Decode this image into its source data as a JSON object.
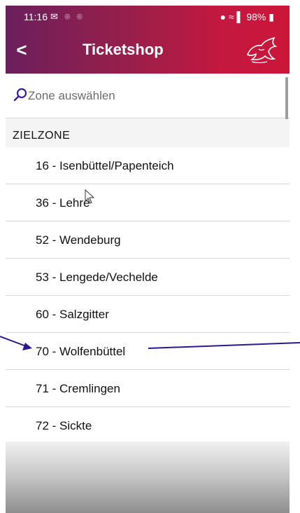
{
  "status": {
    "time": "11:16",
    "left_icons": "✉ ⌾ ⌾",
    "right": "98%",
    "battery_icon": "battery-icon",
    "wifi_icon": "wifi-icon",
    "signal_icon": "signal-icon",
    "location_icon": "location-icon"
  },
  "toolbar": {
    "back_glyph": "<",
    "title": "Ticketshop",
    "logo": "lion-logo-icon"
  },
  "search": {
    "placeholder": "Zone auswählen"
  },
  "section": {
    "label": "ZIELZONE"
  },
  "zones": [
    "16 - Isenbüttel/Papenteich",
    "36 - Lehre",
    "52 - Wendeburg",
    "53 - Lengede/Vechelde",
    "60 - Salzgitter",
    "70 - Wolfenbüttel",
    "71 - Cremlingen",
    "72 - Sickte"
  ],
  "colors": {
    "gradient_start": "#6b1f5c",
    "gradient_end": "#cc1638",
    "annotation": "#2a1a8c"
  }
}
